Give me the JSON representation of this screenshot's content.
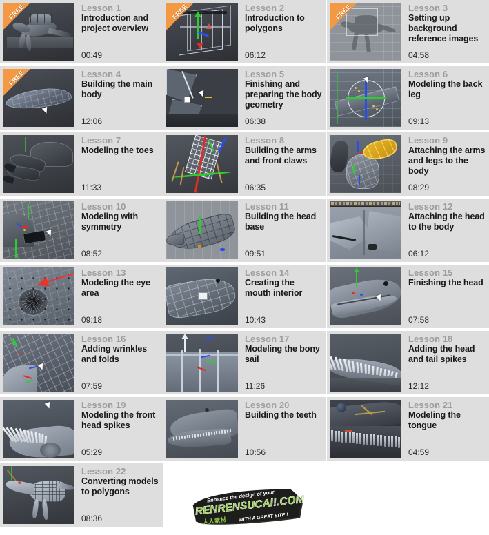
{
  "page": {
    "columns": 3,
    "total_lessons": 22,
    "card_bg": "#dedede",
    "page_bg": "#ffffff",
    "free_badge_color": "#f07d10",
    "lesson_number_color": "#9d9d9d",
    "title_color": "#1a1a1a"
  },
  "badges": {
    "free_label": "FREE"
  },
  "lessons": [
    {
      "number": "Lesson 1",
      "title": "Introduction and project overview",
      "duration": "00:49",
      "free": true,
      "art": "spino-full"
    },
    {
      "number": "Lesson 2",
      "title": "Introduction to polygons",
      "duration": "06:12",
      "free": true,
      "art": "cube-wire"
    },
    {
      "number": "Lesson 3",
      "title": "Setting up background reference images",
      "duration": "04:58",
      "free": true,
      "art": "reference-grid"
    },
    {
      "number": "Lesson 4",
      "title": "Building the main body",
      "duration": "12:06",
      "free": true,
      "art": "body-blob"
    },
    {
      "number": "Lesson 5",
      "title": "Finishing and preparing the body geometry",
      "duration": "06:38",
      "free": false,
      "art": "polygon-edit"
    },
    {
      "number": "Lesson 6",
      "title": "Modeling the back leg",
      "duration": "09:13",
      "free": false,
      "art": "manipulator"
    },
    {
      "number": "Lesson 7",
      "title": "Modeling the toes",
      "duration": "11:33",
      "free": false,
      "art": "toes"
    },
    {
      "number": "Lesson 8",
      "title": "Building the arms and front claws",
      "duration": "06:35",
      "free": false,
      "art": "claws"
    },
    {
      "number": "Lesson 9",
      "title": "Attaching the arms and legs to the body",
      "duration": "08:29",
      "free": false,
      "art": "attach-limb"
    },
    {
      "number": "Lesson 10",
      "title": "Modeling with symmetry",
      "duration": "08:52",
      "free": false,
      "art": "symmetry"
    },
    {
      "number": "Lesson 11",
      "title": "Building the head base",
      "duration": "09:51",
      "free": false,
      "art": "head-base"
    },
    {
      "number": "Lesson 12",
      "title": "Attaching the head to the body",
      "duration": "06:12",
      "free": false,
      "art": "head-attach"
    },
    {
      "number": "Lesson 13",
      "title": "Modeling the eye area",
      "duration": "09:18",
      "free": false,
      "art": "eye-area"
    },
    {
      "number": "Lesson 14",
      "title": "Creating the mouth interior",
      "duration": "10:43",
      "free": false,
      "art": "mouth-interior"
    },
    {
      "number": "Lesson 15",
      "title": "Finishing the head",
      "duration": "07:58",
      "free": false,
      "art": "finished-head"
    },
    {
      "number": "Lesson 16",
      "title": "Adding wrinkles and folds",
      "duration": "07:59",
      "free": false,
      "art": "wrinkles"
    },
    {
      "number": "Lesson 17",
      "title": "Modeling the bony sail",
      "duration": "11:26",
      "free": false,
      "art": "bony-sail"
    },
    {
      "number": "Lesson 18",
      "title": "Adding the head and tail spikes",
      "duration": "12:12",
      "free": false,
      "art": "tail-spikes"
    },
    {
      "number": "Lesson 19",
      "title": "Modeling the front head spikes",
      "duration": "05:29",
      "free": false,
      "art": "head-spikes"
    },
    {
      "number": "Lesson 20",
      "title": "Building the teeth",
      "duration": "10:56",
      "free": false,
      "art": "teeth"
    },
    {
      "number": "Lesson 21",
      "title": "Modeling the tongue",
      "duration": "04:59",
      "free": false,
      "art": "tongue"
    },
    {
      "number": "Lesson 22",
      "title": "Converting models to polygons",
      "duration": "08:36",
      "free": false,
      "art": "spino-wire"
    }
  ],
  "watermark": {
    "tagline": "Enhance the design of your",
    "brand": "RENRENSUCAI!.COM",
    "chinese": "人人素材",
    "subline": "WITH A GREAT SITE !",
    "brand_color": "#8dc63f",
    "dark_color": "#1d1d1b"
  }
}
